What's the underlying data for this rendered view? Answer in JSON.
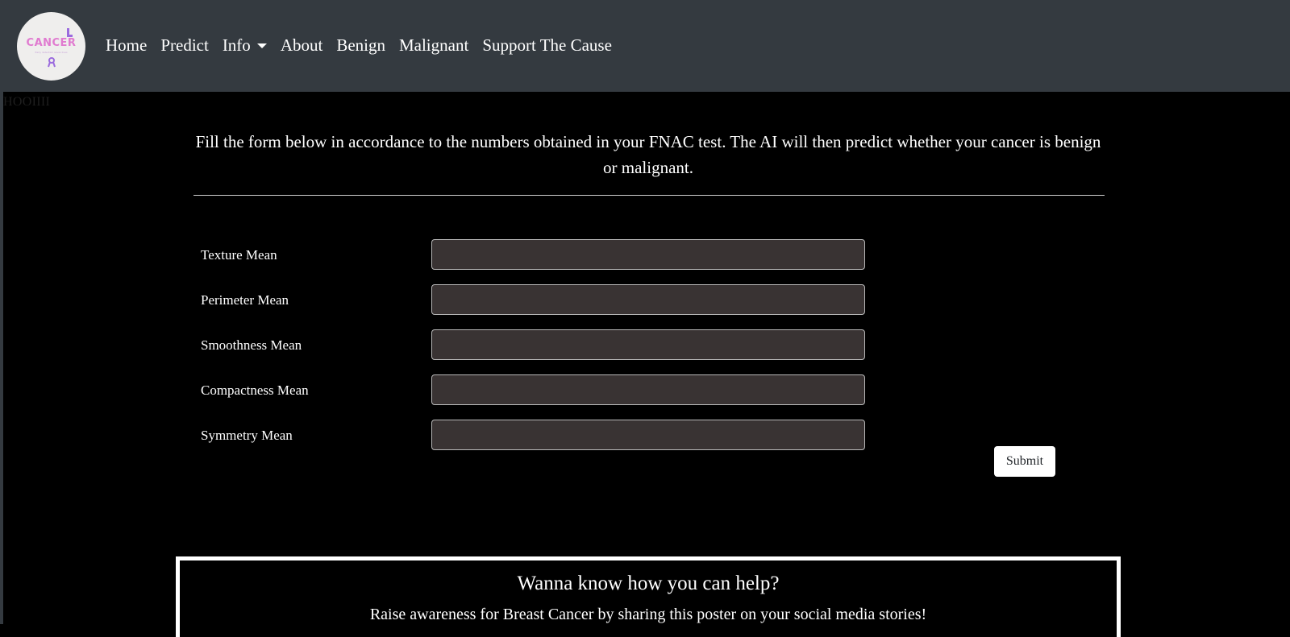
{
  "navbar": {
    "logo": {
      "word": "CANCER",
      "tagline": "Early detection saves lives",
      "ribbon_icon": "ribbon-icon",
      "colors": {
        "word": "#e07bd0",
        "accent": "#9b6bde",
        "background": "#efeeed"
      }
    },
    "links": [
      {
        "label": "Home"
      },
      {
        "label": "Predict"
      },
      {
        "label": "Info"
      },
      {
        "label": "About"
      },
      {
        "label": "Benign"
      },
      {
        "label": "Malignant"
      },
      {
        "label": "Support The Cause"
      }
    ],
    "dropdown_icon": "caret-down-icon"
  },
  "debug_text": "HOOIIII",
  "form": {
    "intro": "Fill the form below in accordance to the numbers obtained in your FNAC test. The AI will then predict whether your cancer is benign or malignant.",
    "fields": [
      {
        "label": "Texture Mean",
        "value": ""
      },
      {
        "label": "Perimeter Mean",
        "value": ""
      },
      {
        "label": "Smoothness Mean",
        "value": ""
      },
      {
        "label": "Compactness Mean",
        "value": ""
      },
      {
        "label": "Symmetry Mean",
        "value": ""
      }
    ],
    "submit_label": "Submit"
  },
  "help": {
    "title": "Wanna know how you can help?",
    "text": "Raise awareness for Breast Cancer by sharing this poster on your social media stories!"
  },
  "colors": {
    "navbar_bg": "#343a40",
    "page_bg": "#000000",
    "input_bg": "#393333",
    "text": "#ffffff"
  }
}
